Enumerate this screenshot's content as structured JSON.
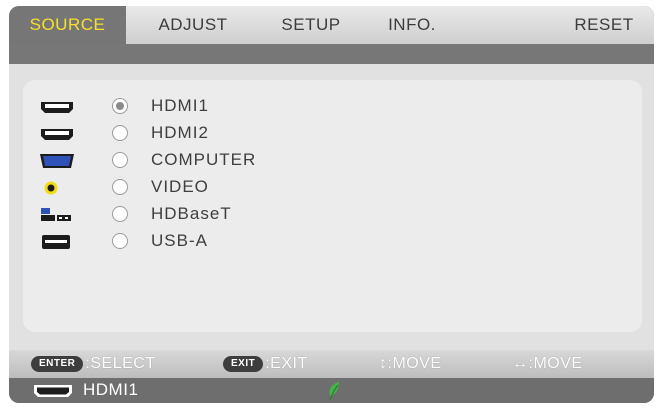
{
  "tabs": [
    {
      "label": "SOURCE",
      "active": true
    },
    {
      "label": "ADJUST",
      "active": false
    },
    {
      "label": "SETUP",
      "active": false
    },
    {
      "label": "INFO.",
      "active": false
    },
    {
      "label": "RESET",
      "active": false
    }
  ],
  "sources": [
    {
      "label": "HDMI1",
      "icon": "hdmi-icon",
      "selected": true
    },
    {
      "label": "HDMI2",
      "icon": "hdmi-icon",
      "selected": false
    },
    {
      "label": "COMPUTER",
      "icon": "vga-computer-icon",
      "selected": false
    },
    {
      "label": "VIDEO",
      "icon": "rca-video-icon",
      "selected": false
    },
    {
      "label": "HDBaseT",
      "icon": "hdbaset-network-icon",
      "selected": false
    },
    {
      "label": "USB-A",
      "icon": "usb-icon",
      "selected": false
    }
  ],
  "help": {
    "enter_key": "ENTER",
    "select_text": ":SELECT",
    "exit_key": "EXIT",
    "exit_text": ":EXIT",
    "move_vertical": "↕:MOVE",
    "move_horizontal": "↔:MOVE"
  },
  "status": {
    "current_input": "HDMI1",
    "input_icon": "hdmi-icon",
    "eco_icon": "eco-leaf-icon"
  },
  "colors": {
    "active_tab_text": "#f6e02a",
    "eco_leaf": "#46b24a"
  }
}
